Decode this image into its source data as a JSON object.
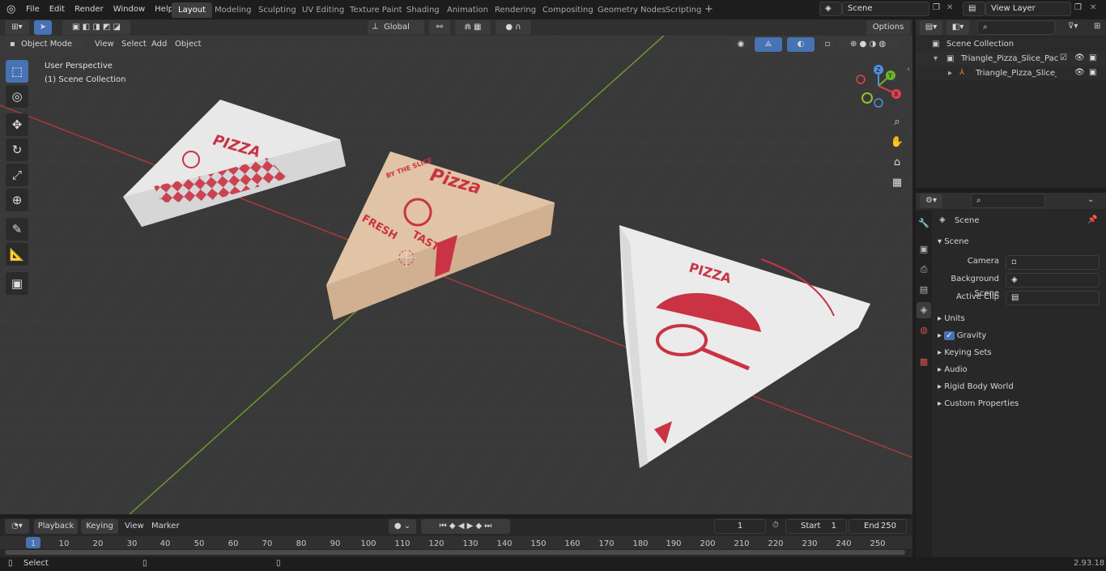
{
  "menu": {
    "file": "File",
    "edit": "Edit",
    "render": "Render",
    "window": "Window",
    "help": "Help"
  },
  "workspaces": [
    "Layout",
    "Modeling",
    "Sculpting",
    "UV Editing",
    "Texture Paint",
    "Shading",
    "Animation",
    "Rendering",
    "Compositing",
    "Geometry Nodes",
    "Scripting"
  ],
  "scene_field": "Scene",
  "view_layer_field": "View Layer",
  "viewport": {
    "mode": "Object Mode",
    "view": "View",
    "select": "Select",
    "add": "Add",
    "object": "Object",
    "transform": "Global",
    "options": "Options",
    "overlay_title": "User Perspective",
    "overlay_sub": "(1) Scene Collection"
  },
  "gizmo": {
    "x": "X",
    "y": "Y",
    "z": "Z"
  },
  "outliner": {
    "root": "Scene Collection",
    "item1": "Triangle_Pizza_Slice_Packaging",
    "item2": "Triangle_Pizza_Slice_Pack"
  },
  "properties": {
    "scene_tab": "Scene",
    "section": "Scene",
    "camera": "Camera",
    "background_scene": "Background Scene",
    "active_clip": "Active Clip",
    "units": "Units",
    "gravity": "Gravity",
    "keying_sets": "Keying Sets",
    "audio": "Audio",
    "rigid_body": "Rigid Body World",
    "custom_props": "Custom Properties"
  },
  "timeline": {
    "playback": "Playback",
    "keying": "Keying",
    "view": "View",
    "marker": "Marker",
    "current_frame": "1",
    "start_label": "Start",
    "start": "1",
    "end_label": "End",
    "end": "250",
    "ticks": [
      "1",
      "10",
      "20",
      "30",
      "40",
      "50",
      "60",
      "70",
      "80",
      "90",
      "100",
      "110",
      "120",
      "130",
      "140",
      "150",
      "160",
      "170",
      "180",
      "190",
      "200",
      "210",
      "220",
      "230",
      "240",
      "250"
    ]
  },
  "status": {
    "select": "Select",
    "version": "2.93.18"
  },
  "boxes": {
    "left_title": "PIZZA",
    "middle_title": "Pizza",
    "middle_fresh": "FRESH",
    "middle_tasty": "TASTY",
    "middle_slice": "BY THE SLICE",
    "right_title": "PIZZA"
  }
}
